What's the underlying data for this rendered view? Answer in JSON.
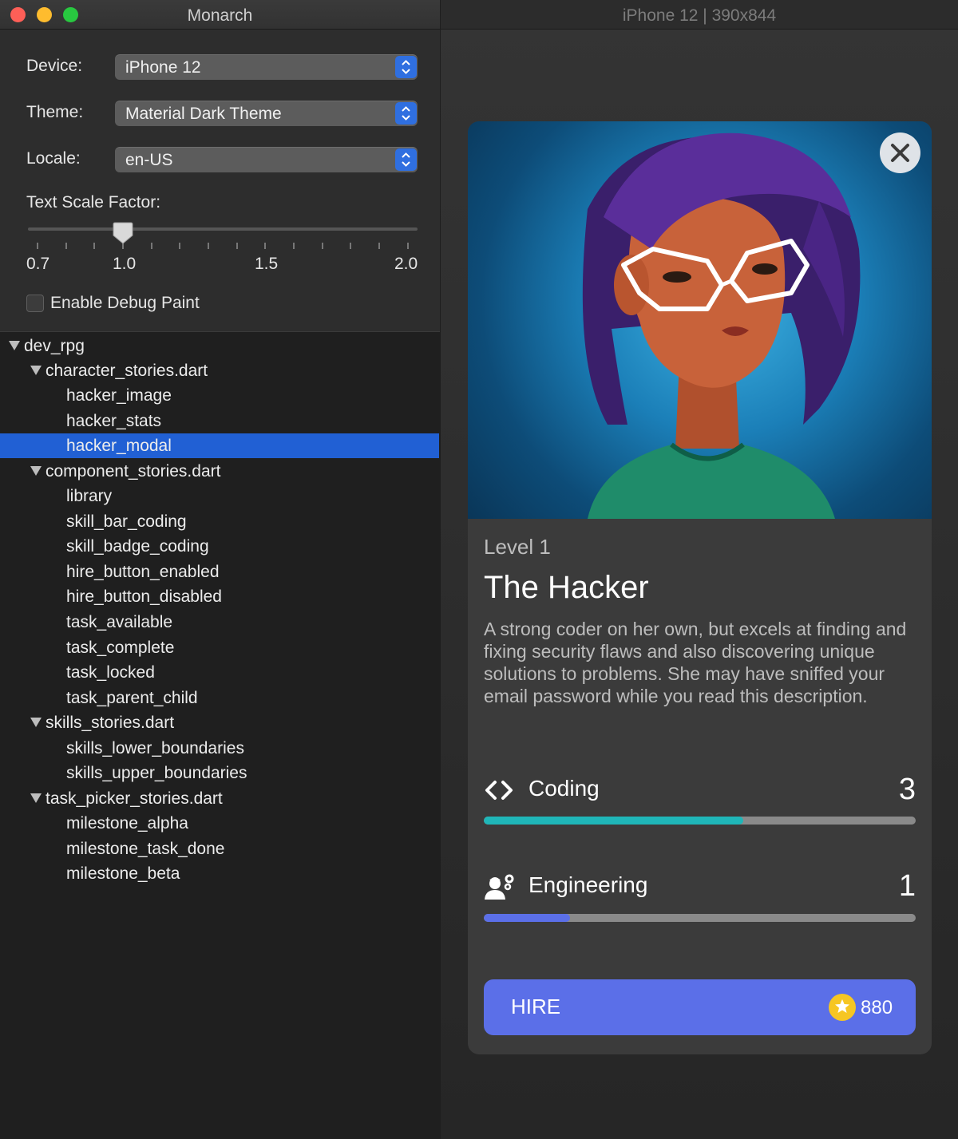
{
  "left_window": {
    "title": "Monarch",
    "device": {
      "label": "Device:",
      "value": "iPhone 12"
    },
    "theme": {
      "label": "Theme:",
      "value": "Material Dark Theme"
    },
    "locale": {
      "label": "Locale:",
      "value": "en-US"
    },
    "text_scale": {
      "label": "Text Scale Factor:",
      "ticks": [
        "0.7",
        "1.0",
        "1.5",
        "2.0"
      ],
      "value": 1.0
    },
    "debug_paint": {
      "label": "Enable Debug Paint",
      "checked": false
    },
    "tree": {
      "root": "dev_rpg",
      "groups": [
        {
          "file": "character_stories.dart",
          "items": [
            "hacker_image",
            "hacker_stats",
            "hacker_modal"
          ]
        },
        {
          "file": "component_stories.dart",
          "items": [
            "library",
            "skill_bar_coding",
            "skill_badge_coding",
            "hire_button_enabled",
            "hire_button_disabled",
            "task_available",
            "task_complete",
            "task_locked",
            "task_parent_child"
          ]
        },
        {
          "file": "skills_stories.dart",
          "items": [
            "skills_lower_boundaries",
            "skills_upper_boundaries"
          ]
        },
        {
          "file": "task_picker_stories.dart",
          "items": [
            "milestone_alpha",
            "milestone_task_done",
            "milestone_beta"
          ]
        }
      ],
      "selected": "hacker_modal"
    }
  },
  "right_window": {
    "title": "iPhone 12 | 390x844",
    "card": {
      "level": "Level 1",
      "name": "The Hacker",
      "description": "A strong coder on her own, but excels at finding and fixing security flaws and also discovering unique solutions to problems. She may have sniffed your email password while you read this description.",
      "skills": [
        {
          "icon": "code-icon",
          "name": "Coding",
          "value": "3",
          "progress": 0.6,
          "color": "#1fb6b8"
        },
        {
          "icon": "engineering-icon",
          "name": "Engineering",
          "value": "1",
          "progress": 0.2,
          "color": "#5b6fe8"
        }
      ],
      "hire": {
        "label": "HIRE",
        "price": "880"
      }
    }
  }
}
